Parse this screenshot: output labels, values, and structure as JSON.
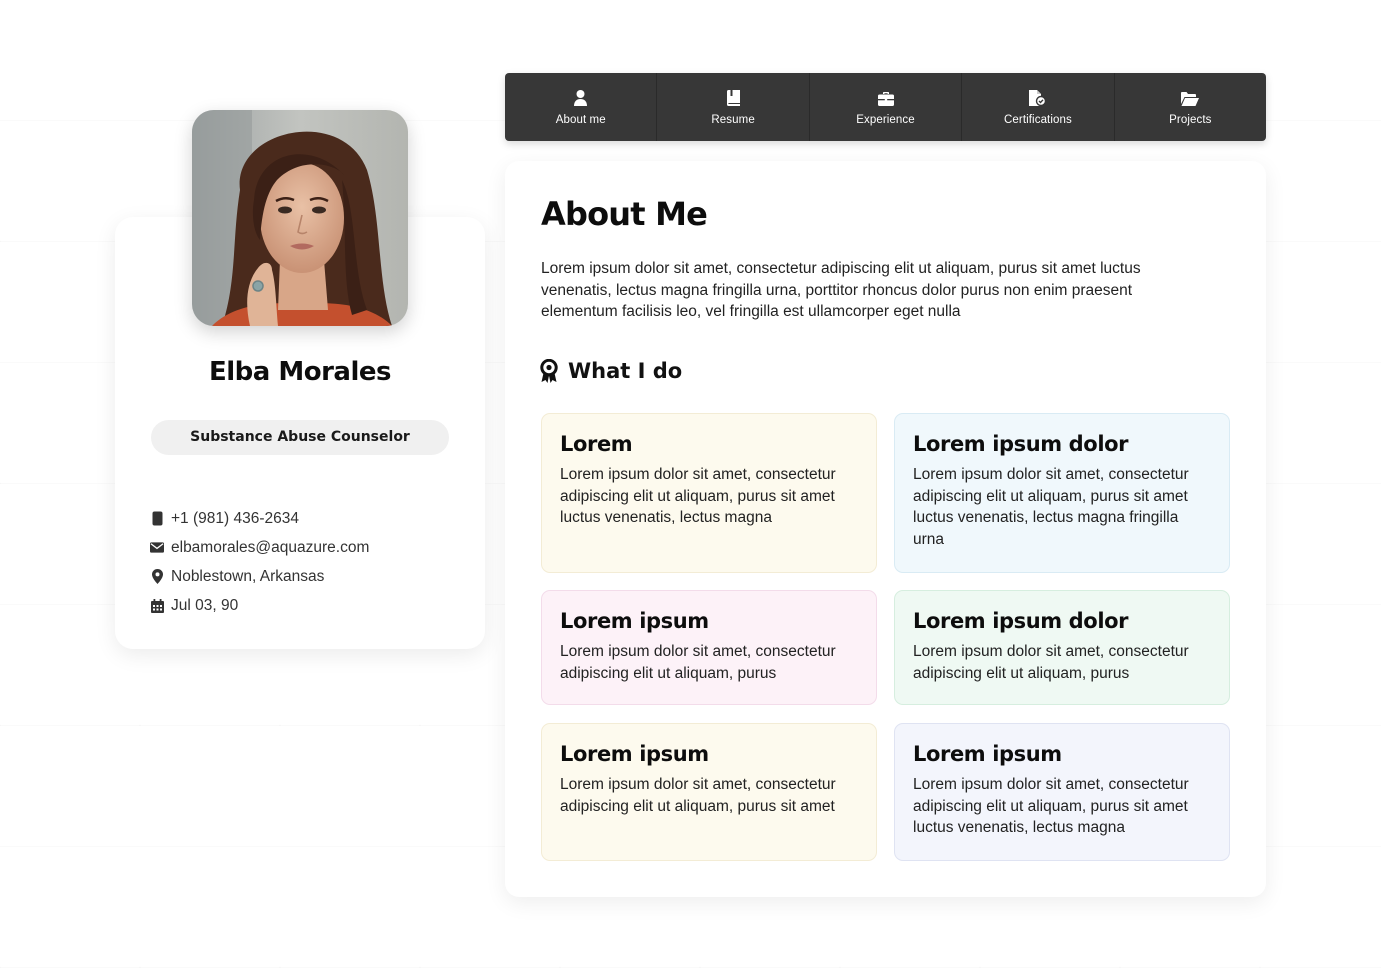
{
  "profile": {
    "name": "Elba Morales",
    "role": "Substance Abuse Counselor",
    "contacts": [
      {
        "icon": "phone-icon",
        "text": "+1 (981) 436-2634"
      },
      {
        "icon": "envelope-icon",
        "text": "elbamorales@aquazure.com"
      },
      {
        "icon": "location-pin-icon",
        "text": "Noblestown, Arkansas"
      },
      {
        "icon": "calendar-icon",
        "text": "Jul 03, 90"
      }
    ]
  },
  "nav": {
    "items": [
      {
        "label": "About me",
        "icon": "user-icon"
      },
      {
        "label": "Resume",
        "icon": "book-icon"
      },
      {
        "label": "Experience",
        "icon": "briefcase-icon"
      },
      {
        "label": "Certifications",
        "icon": "certificate-file-icon"
      },
      {
        "label": "Projects",
        "icon": "folder-open-icon"
      }
    ]
  },
  "about": {
    "title": "About Me",
    "text": "Lorem ipsum dolor sit amet, consectetur adipiscing elit ut aliquam, purus sit amet luctus venenatis, lectus magna fringilla urna, porttitor rhoncus dolor purus non enim praesent elementum facilisis leo, vel fringilla est ullamcorper eget nulla"
  },
  "whatido": {
    "title": "What I do",
    "icon": "award-ribbon-icon",
    "cards": [
      {
        "title": "Lorem",
        "text": "Lorem ipsum dolor sit amet, consectetur adipiscing elit ut aliquam, purus sit amet luctus venenatis, lectus magna",
        "bg": "#fdfaee",
        "border": "#f3ecd5"
      },
      {
        "title": "Lorem ipsum dolor",
        "text": "Lorem ipsum dolor sit amet, consectetur adipiscing elit ut aliquam, purus sit amet luctus venenatis, lectus magna fringilla urna",
        "bg": "#f0f8fc",
        "border": "#d9ebf4"
      },
      {
        "title": "Lorem ipsum",
        "text": "Lorem ipsum dolor sit amet, consectetur adipiscing elit ut aliquam, purus",
        "bg": "#fdf2f8",
        "border": "#f3dcea"
      },
      {
        "title": "Lorem ipsum dolor",
        "text": "Lorem ipsum dolor sit amet, consectetur adipiscing elit ut aliquam, purus",
        "bg": "#eff9f3",
        "border": "#d6eedf"
      },
      {
        "title": "Lorem ipsum",
        "text": "Lorem ipsum dolor sit amet, consectetur adipiscing elit ut aliquam, purus sit amet",
        "bg": "#fdfaee",
        "border": "#f3ecd5"
      },
      {
        "title": "Lorem ipsum",
        "text": "Lorem ipsum dolor sit amet, consectetur adipiscing elit ut aliquam, purus sit amet luctus venenatis, lectus magna",
        "bg": "#f3f5fc",
        "border": "#dfe3f2"
      }
    ]
  }
}
